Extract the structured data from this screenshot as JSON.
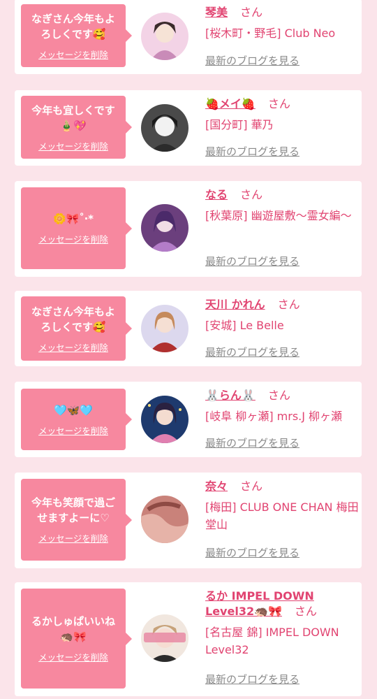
{
  "cards": [
    {
      "message": "なぎさん今年もよろしくです🥰",
      "delete_label": "メッセージを削除",
      "name": "琴美",
      "honorific": "さん",
      "shop": "[桜木町・野毛] Club Neo",
      "blog_label": "最新のブログを見る",
      "avatar": {
        "bg": "#f3d3e6",
        "accent": "#c98bb8"
      }
    },
    {
      "message": "今年も宜しくです🎍💖",
      "delete_label": "メッセージを削除",
      "name": "🍓メイ🍓",
      "honorific": "さん",
      "shop": "[国分町] 華乃",
      "blog_label": "最新のブログを見る",
      "avatar": {
        "bg": "#4a4a4a",
        "accent": "#e8e8e8"
      }
    },
    {
      "message": "🌼🎀˚‧*",
      "delete_label": "メッセージを削除",
      "name": "なる",
      "honorific": "さん",
      "shop": "[秋葉原] 幽遊屋敷〜霊女編〜",
      "blog_label": "最新のブログを見る",
      "avatar": {
        "bg": "#6b3f7d",
        "accent": "#b37cc8"
      }
    },
    {
      "message": "なぎさん今年もよろしくです🥰",
      "delete_label": "メッセージを削除",
      "name": "天川 かれん",
      "honorific": "さん",
      "shop": "[安城] Le Belle",
      "blog_label": "最新のブログを見る",
      "avatar": {
        "bg": "#dcd8ee",
        "accent": "#b0302f"
      }
    },
    {
      "message": "🩵🦋🩵",
      "delete_label": "メッセージを削除",
      "name": "🐰らん🐰",
      "honorific": "さん",
      "shop": "[岐阜 柳ヶ瀬] mrs.J 柳ヶ瀬",
      "blog_label": "最新のブログを見る",
      "avatar": {
        "bg": "#1e3a6e",
        "accent": "#e07fb0"
      }
    },
    {
      "message": "今年も笑顔で過ごせますよーに♡",
      "delete_label": "メッセージを削除",
      "name": "奈々",
      "honorific": "さん",
      "shop": "[梅田] CLUB ONE CHAN 梅田堂山",
      "blog_label": "最新のブログを見る",
      "avatar": {
        "bg": "#c9827a",
        "accent": "#8e4a44"
      }
    },
    {
      "message": "るかしゅぱいいね🦔🎀",
      "delete_label": "メッセージを削除",
      "name": "るか IMPEL DOWN Level32🦔🎀",
      "honorific": "さん",
      "shop": "[名古屋 錦] IMPEL DOWN Level32",
      "blog_label": "最新のブログを見る",
      "avatar": {
        "bg": "#f1e7df",
        "accent": "#e78aa4"
      }
    }
  ]
}
